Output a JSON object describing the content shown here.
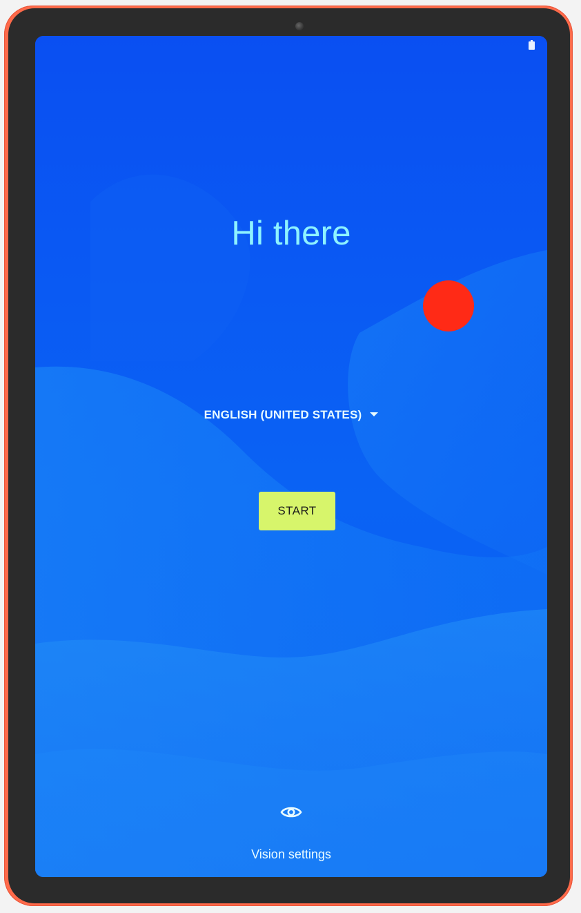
{
  "screen": {
    "title": "Hi there",
    "language": {
      "selected": "ENGLISH (UNITED STATES)",
      "caret_icon": "arrow-drop-down-icon"
    },
    "start_button": {
      "label": "START"
    },
    "vision_settings": {
      "label": "Vision settings",
      "icon": "eye-icon"
    },
    "status_bar": {
      "battery_icon": "battery-icon"
    }
  },
  "colors": {
    "device_frame": "#ff6a4a",
    "bezel": "#2b2b2b",
    "screen_background": "#0a55f0",
    "title_text": "#8ef3ff",
    "start_button": "#d7f56b",
    "touch_indicator": "#ff2a16"
  }
}
